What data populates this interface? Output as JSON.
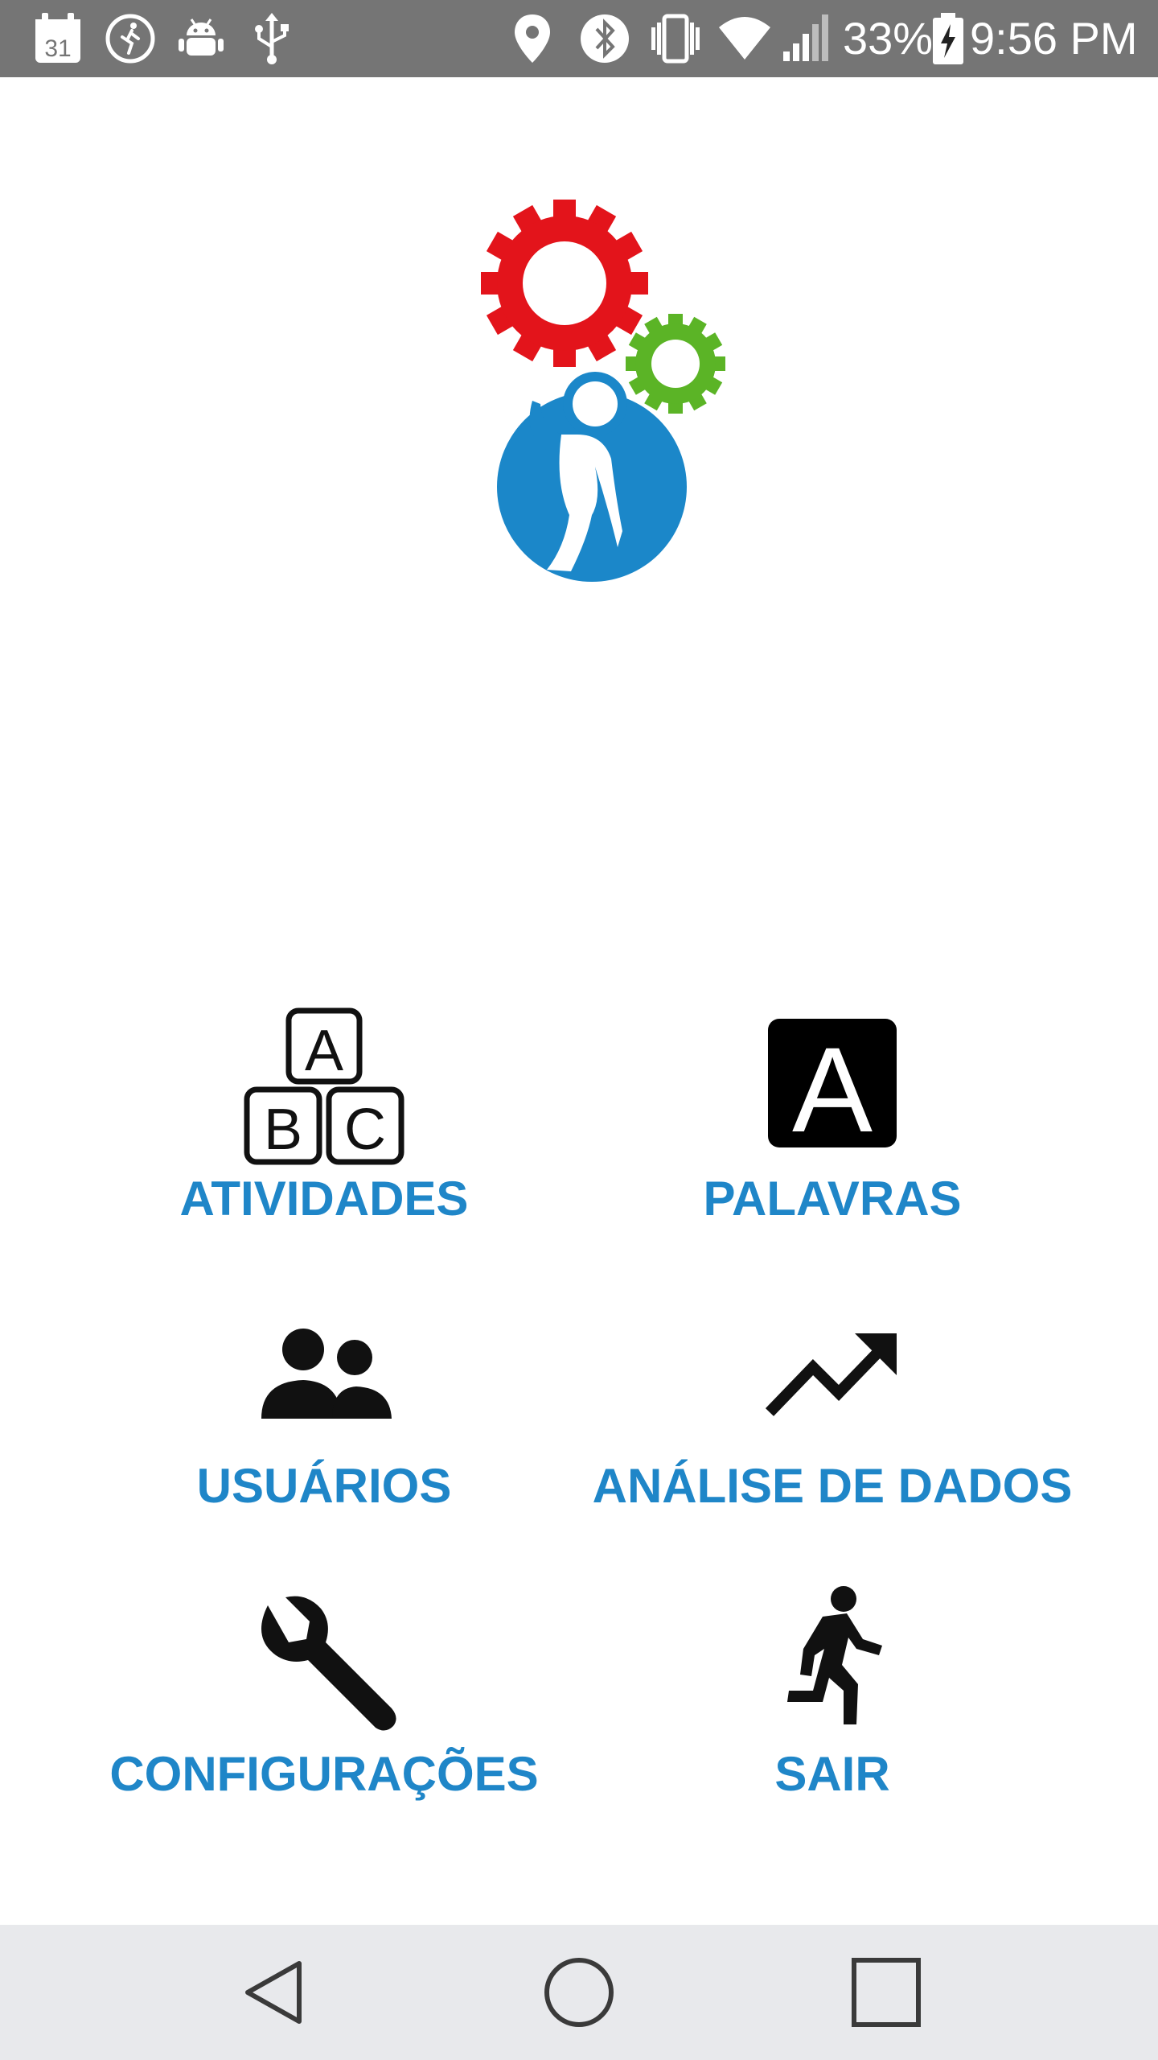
{
  "status_bar": {
    "calendar_day": "31",
    "battery_percent": "33%",
    "time": "9:56 PM"
  },
  "app": {
    "logo": "app-logo-gears-person",
    "colors": {
      "label": "#1f86c8",
      "gear_red": "#e3141b",
      "gear_green": "#5bb426",
      "person_blue": "#1b87c9",
      "status_bar": "#757575",
      "nav_bar": "#e8e9ec"
    }
  },
  "menu": {
    "activities": {
      "label": "ATIVIDADES",
      "icon": "abc-blocks-icon"
    },
    "words": {
      "label": "PALAVRAS",
      "icon": "letter-a-icon"
    },
    "users": {
      "label": "USUÁRIOS",
      "icon": "people-icon"
    },
    "analytics": {
      "label": "ANÁLISE DE DADOS",
      "icon": "trending-up-icon"
    },
    "settings": {
      "label": "CONFIGURAÇÕES",
      "icon": "wrench-icon"
    },
    "exit": {
      "label": "SAIR",
      "icon": "running-person-icon"
    }
  },
  "nav_bar": {
    "back": "back-triangle-icon",
    "home": "home-circle-icon",
    "recents": "recents-square-icon"
  }
}
